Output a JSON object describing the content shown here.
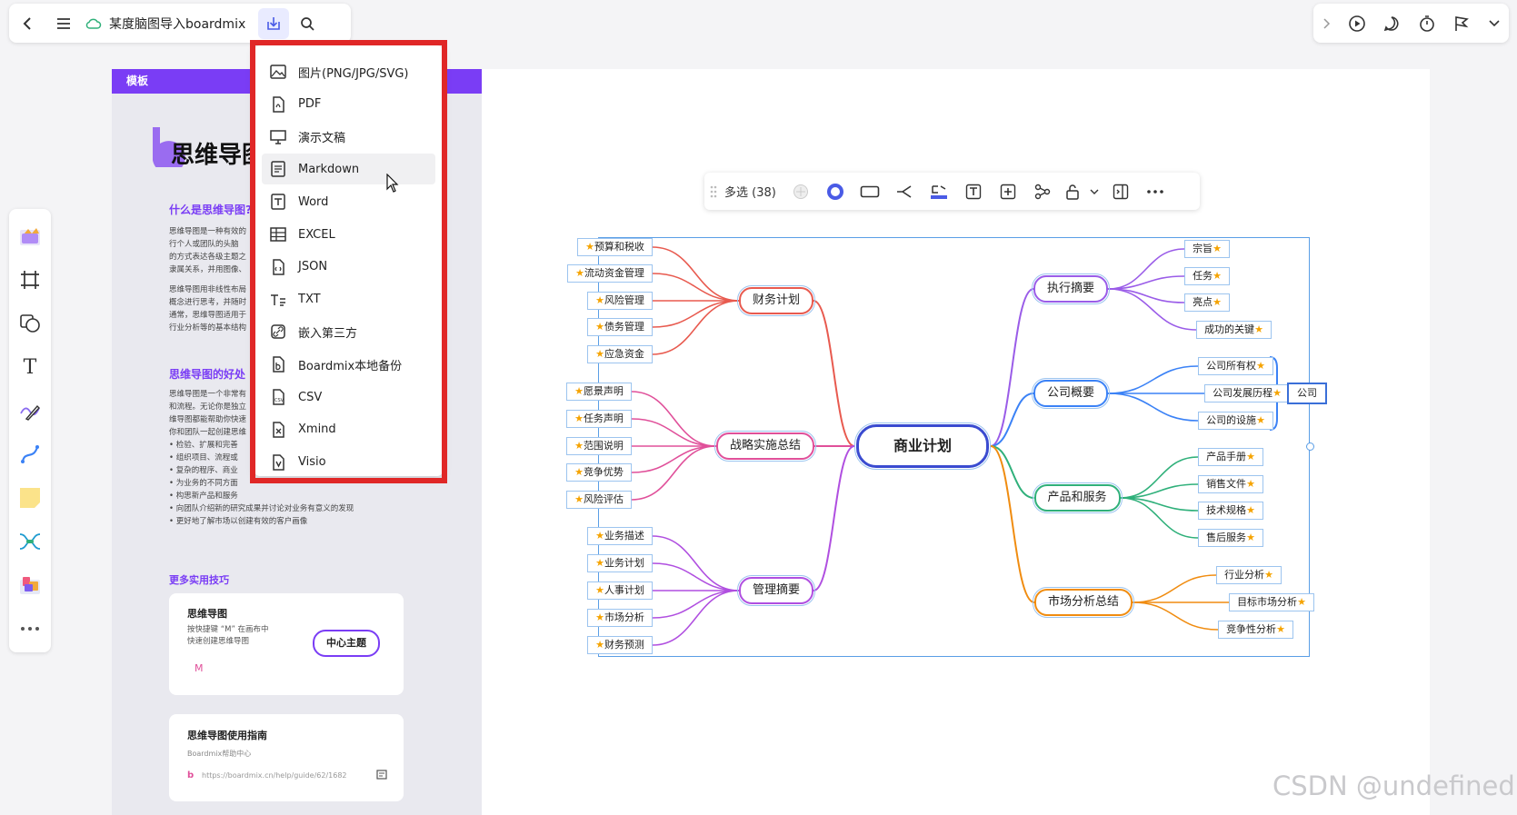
{
  "topbar": {
    "title": "某度脑图导入boardmix",
    "back_icon": "chevron-left-icon",
    "menu_icon": "hamburger-icon",
    "cloud_icon": "cloud-synced-icon",
    "export_icon": "export-download-icon",
    "search_icon": "search-icon"
  },
  "topright": {
    "icons": [
      "chevron-right-icon",
      "play-icon",
      "comment-icon",
      "timer-icon",
      "flag-icon",
      "chevron-down-icon"
    ]
  },
  "export_menu": {
    "items": [
      {
        "label": "图片(PNG/JPG/SVG)",
        "icon": "image-icon"
      },
      {
        "label": "PDF",
        "icon": "pdf-icon"
      },
      {
        "label": "演示文稿",
        "icon": "presentation-icon"
      },
      {
        "label": "Markdown",
        "icon": "markdown-icon"
      },
      {
        "label": "Word",
        "icon": "word-icon"
      },
      {
        "label": "EXCEL",
        "icon": "excel-icon"
      },
      {
        "label": "JSON",
        "icon": "json-icon"
      },
      {
        "label": "TXT",
        "icon": "txt-icon"
      },
      {
        "label": "嵌入第三方",
        "icon": "embed-link-icon"
      },
      {
        "label": "Boardmix本地备份",
        "icon": "boardmix-backup-icon"
      },
      {
        "label": "CSV",
        "icon": "csv-icon"
      },
      {
        "label": "Xmind",
        "icon": "xmind-icon"
      },
      {
        "label": "Visio",
        "icon": "visio-icon"
      }
    ],
    "hovered": "Markdown"
  },
  "template_panel": {
    "bar_label": "模板",
    "title": "思维导图",
    "sec1_heading": "什么是思维导图?",
    "sec1_p1": [
      "思维导图是一种有效的",
      "行个人或团队的头脑",
      "的方式表达各级主题之",
      "隶属关系，并用图像、"
    ],
    "sec1_p2": [
      "思维导图用非线性布局",
      "概念进行思考，并随时",
      "通常，思维导图适用于",
      "行业分析等的基本结构"
    ],
    "sec2_heading": "思维导图的好处",
    "sec2_p": [
      "思维导图是一个非常有",
      "和流程。无论你是独立",
      "维导图都能帮助你快速",
      "你和团队一起创建思维"
    ],
    "bullets": [
      "检验、扩展和完善",
      "组织项目、流程或",
      "复杂的程序、商业",
      "为业务的不同方面",
      "构思新产品和服务",
      "向团队介绍新的研究成果并讨论对业务有意义的发现",
      "更好地了解市场以创建有效的客户画像"
    ],
    "sec3_heading": "更多实用技巧",
    "card1": {
      "title": "思维导图",
      "desc1": "按快捷键 “M” 在画布中",
      "desc2": "快速创建思维导图",
      "key": "M",
      "pill": "中心主题"
    },
    "card2": {
      "title": "思维导图使用指南",
      "sub": "Boardmix帮助中心",
      "url": "https://boardmix.cn/help/guide/62/1682"
    }
  },
  "left_toolbar": {
    "icons": [
      "template-icon",
      "frame-icon",
      "shape-icon",
      "text-icon",
      "pen-icon",
      "connector-icon",
      "sticky-note-icon",
      "mindmap-icon",
      "widget-icon",
      "more-icon"
    ],
    "text_tool_label": "T"
  },
  "float_toolbar": {
    "label": "多选 (38)",
    "icons": [
      "drag-handle-icon",
      "fill-color-icon",
      "border-color-icon",
      "shape-outline-icon",
      "branch-style-icon",
      "layout-icon",
      "text-style-icon",
      "add-node-icon",
      "structure-icon",
      "lock-icon",
      "chevron-down-icon",
      "collapse-panel-icon",
      "more-icon"
    ]
  },
  "mindmap": {
    "center": "商业计划",
    "branches": [
      {
        "label": "财务计划",
        "color": "#e85a4f",
        "leaves": [
          "预算和税收",
          "流动资金管理",
          "风险管理",
          "债务管理",
          "应急资金"
        ]
      },
      {
        "label": "战略实施总结",
        "color": "#e0509a",
        "leaves": [
          "愿景声明",
          "任务声明",
          "范围说明",
          "竞争优势",
          "风险评估"
        ]
      },
      {
        "label": "管理摘要",
        "color": "#b04fe0",
        "leaves": [
          "业务描述",
          "业务计划",
          "人事计划",
          "市场分析",
          "财务预测"
        ]
      },
      {
        "label": "执行摘要",
        "color": "#9a5ce8",
        "leaves": [
          "宗旨",
          "任务",
          "亮点",
          "成功的关键"
        ]
      },
      {
        "label": "公司概要",
        "color": "#3b82f6",
        "leaves": [
          "公司所有权",
          "公司发展历程",
          "公司的设施"
        ]
      },
      {
        "label": "产品和服务",
        "color": "#2fb07a",
        "leaves": [
          "产品手册",
          "销售文件",
          "技术规格",
          "售后服务"
        ]
      },
      {
        "label": "市场分析总结",
        "color": "#f08c10",
        "leaves": [
          "行业分析",
          "目标市场分析",
          "竞争性分析"
        ]
      }
    ],
    "summary": "公司",
    "star": "★"
  },
  "watermark": "CSDN @undefined"
}
